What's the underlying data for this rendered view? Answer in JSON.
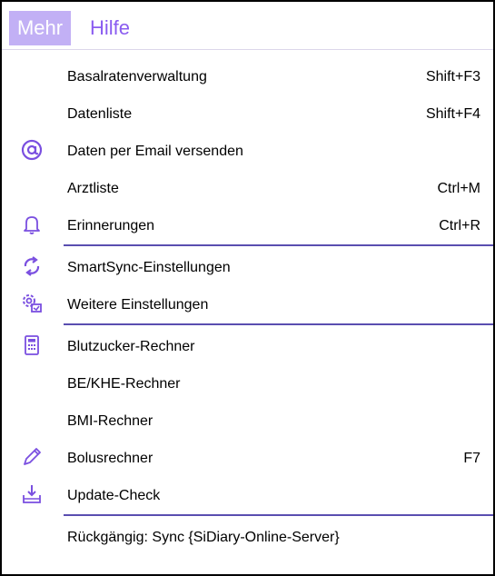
{
  "menubar": {
    "mehr": "Mehr",
    "hilfe": "Hilfe"
  },
  "menu": {
    "items": [
      {
        "label": "Basalratenverwaltung",
        "shortcut": "Shift+F3",
        "icon": "none"
      },
      {
        "label": "Datenliste",
        "shortcut": "Shift+F4",
        "icon": "none"
      },
      {
        "label": "Daten per Email versenden",
        "shortcut": "",
        "icon": "at-icon"
      },
      {
        "label": "Arztliste",
        "shortcut": "Ctrl+M",
        "icon": "none"
      },
      {
        "label": "Erinnerungen",
        "shortcut": "Ctrl+R",
        "icon": "bell-icon"
      },
      {
        "label": "SmartSync-Einstellungen",
        "shortcut": "",
        "icon": "sync-icon"
      },
      {
        "label": "Weitere Einstellungen",
        "shortcut": "",
        "icon": "gears-icon"
      },
      {
        "label": "Blutzucker-Rechner",
        "shortcut": "",
        "icon": "calculator-icon"
      },
      {
        "label": "BE/KHE-Rechner",
        "shortcut": "",
        "icon": "none"
      },
      {
        "label": "BMI-Rechner",
        "shortcut": "",
        "icon": "none"
      },
      {
        "label": "Bolusrechner",
        "shortcut": "F7",
        "icon": "pencil-icon"
      },
      {
        "label": "Update-Check",
        "shortcut": "",
        "icon": "download-tray-icon"
      },
      {
        "label": "Rückgängig: Sync {SiDiary-Online-Server}",
        "shortcut": "",
        "icon": "none"
      }
    ]
  },
  "colors": {
    "accent": "#8a5cf0",
    "active_menu_bg": "#c2b0f5",
    "separator": "#5a4eb0",
    "icon": "#7a4fe0"
  }
}
